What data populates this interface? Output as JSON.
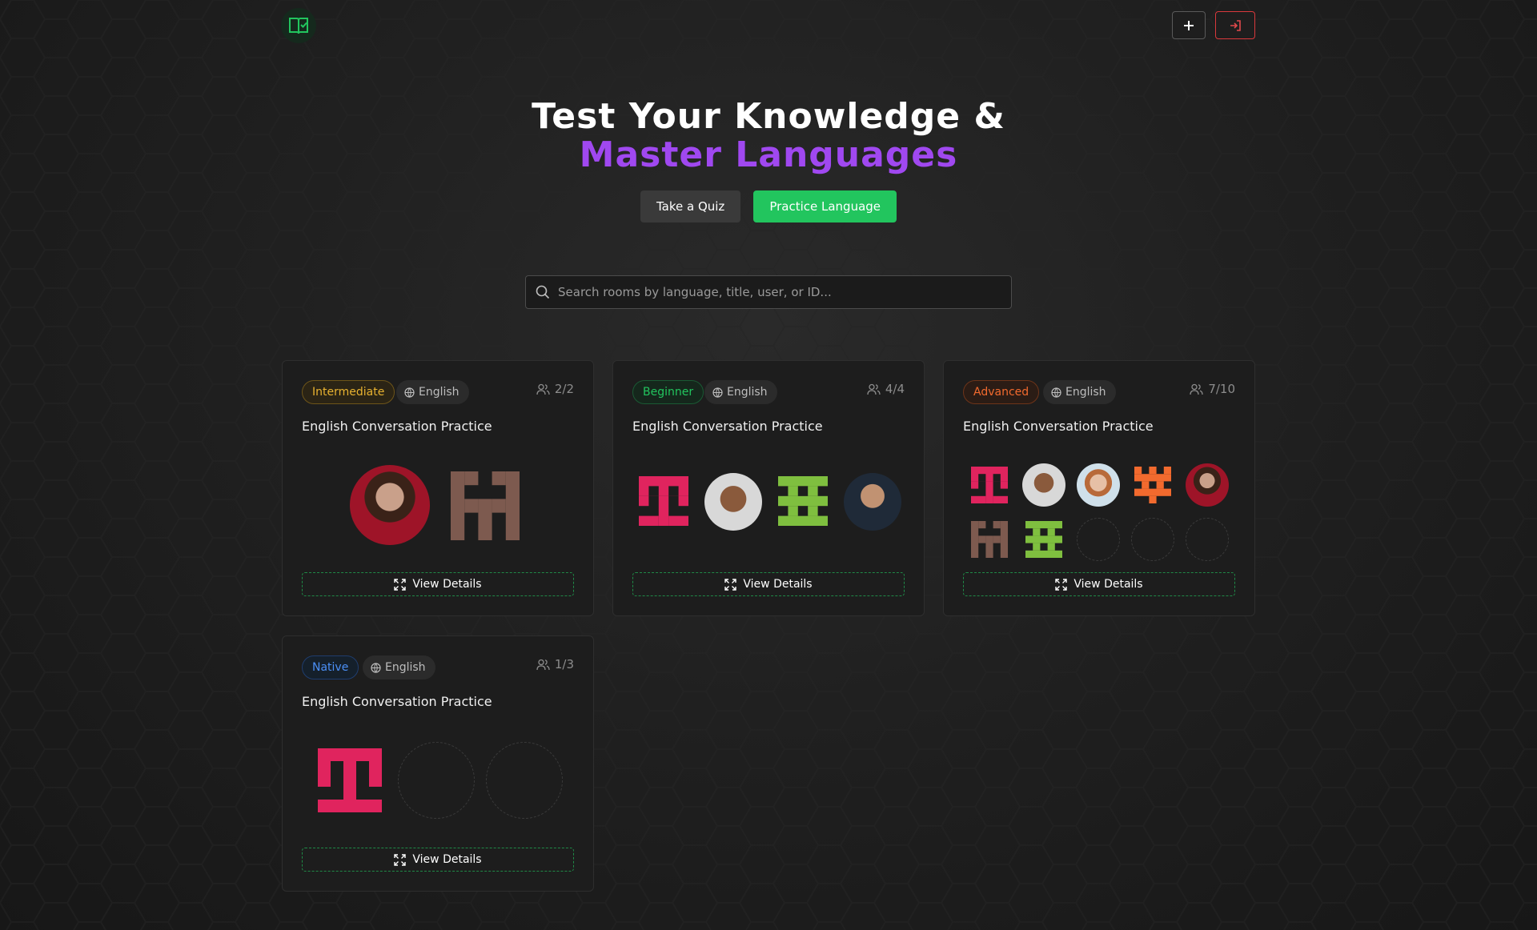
{
  "header": {
    "logo_icon": "book-check-icon",
    "add_icon": "plus-icon",
    "login_icon": "log-in-icon"
  },
  "hero": {
    "title_line1": "Test Your Knowledge &",
    "title_line2": "Master Languages",
    "quiz_label": "Take a Quiz",
    "practice_label": "Practice Language"
  },
  "search": {
    "placeholder": "Search rooms by language, title, user, or ID..."
  },
  "colors": {
    "accent_green": "#22c55e",
    "accent_purple": "#a048f0",
    "danger_red": "#d9393c"
  },
  "rooms": [
    {
      "level": "Intermediate",
      "language": "English",
      "participants": "2/2",
      "title": "English Conversation Practice",
      "view_label": "View Details"
    },
    {
      "level": "Beginner",
      "language": "English",
      "participants": "4/4",
      "title": "English Conversation Practice",
      "view_label": "View Details"
    },
    {
      "level": "Advanced",
      "language": "English",
      "participants": "7/10",
      "title": "English Conversation Practice",
      "view_label": "View Details"
    },
    {
      "level": "Native",
      "language": "English",
      "participants": "1/3",
      "title": "English Conversation Practice",
      "view_label": "View Details"
    }
  ]
}
